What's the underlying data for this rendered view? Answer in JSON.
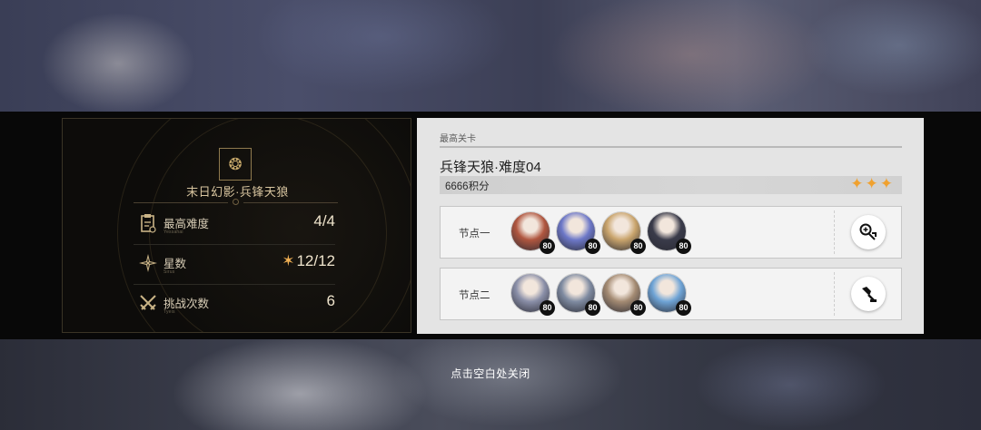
{
  "left": {
    "title": "末日幻影·兵锋天狼",
    "stats": [
      {
        "label": "最高难度",
        "sub": "Yessahai",
        "value": "4/4",
        "icon": "clipboard-icon"
      },
      {
        "label": "星数",
        "sub": "Sirus",
        "value": "12/12",
        "icon": "compass-star-icon"
      },
      {
        "label": "挑战次数",
        "sub": "Tyeis",
        "value": "6",
        "icon": "crossed-swords-icon"
      }
    ]
  },
  "right": {
    "header": "最高关卡",
    "stage": "兵锋天狼·难度04",
    "score": "6666积分",
    "stars": "✦✦✦",
    "nodes": [
      {
        "label": "节点一",
        "avatars": [
          {
            "level": "80",
            "color": "#b0563f"
          },
          {
            "level": "80",
            "color": "#6d78c8"
          },
          {
            "level": "80",
            "color": "#c9a46c"
          },
          {
            "level": "80",
            "color": "#3a3b4a"
          }
        ],
        "action_icon": "search-swap-icon"
      },
      {
        "label": "节点二",
        "avatars": [
          {
            "level": "80",
            "color": "#8a8fa8"
          },
          {
            "level": "80",
            "color": "#7f8ba1"
          },
          {
            "level": "80",
            "color": "#a48b73"
          },
          {
            "level": "80",
            "color": "#6fa4d6"
          }
        ],
        "action_icon": "build-icon"
      }
    ]
  },
  "close_hint": "点击空白处关闭"
}
